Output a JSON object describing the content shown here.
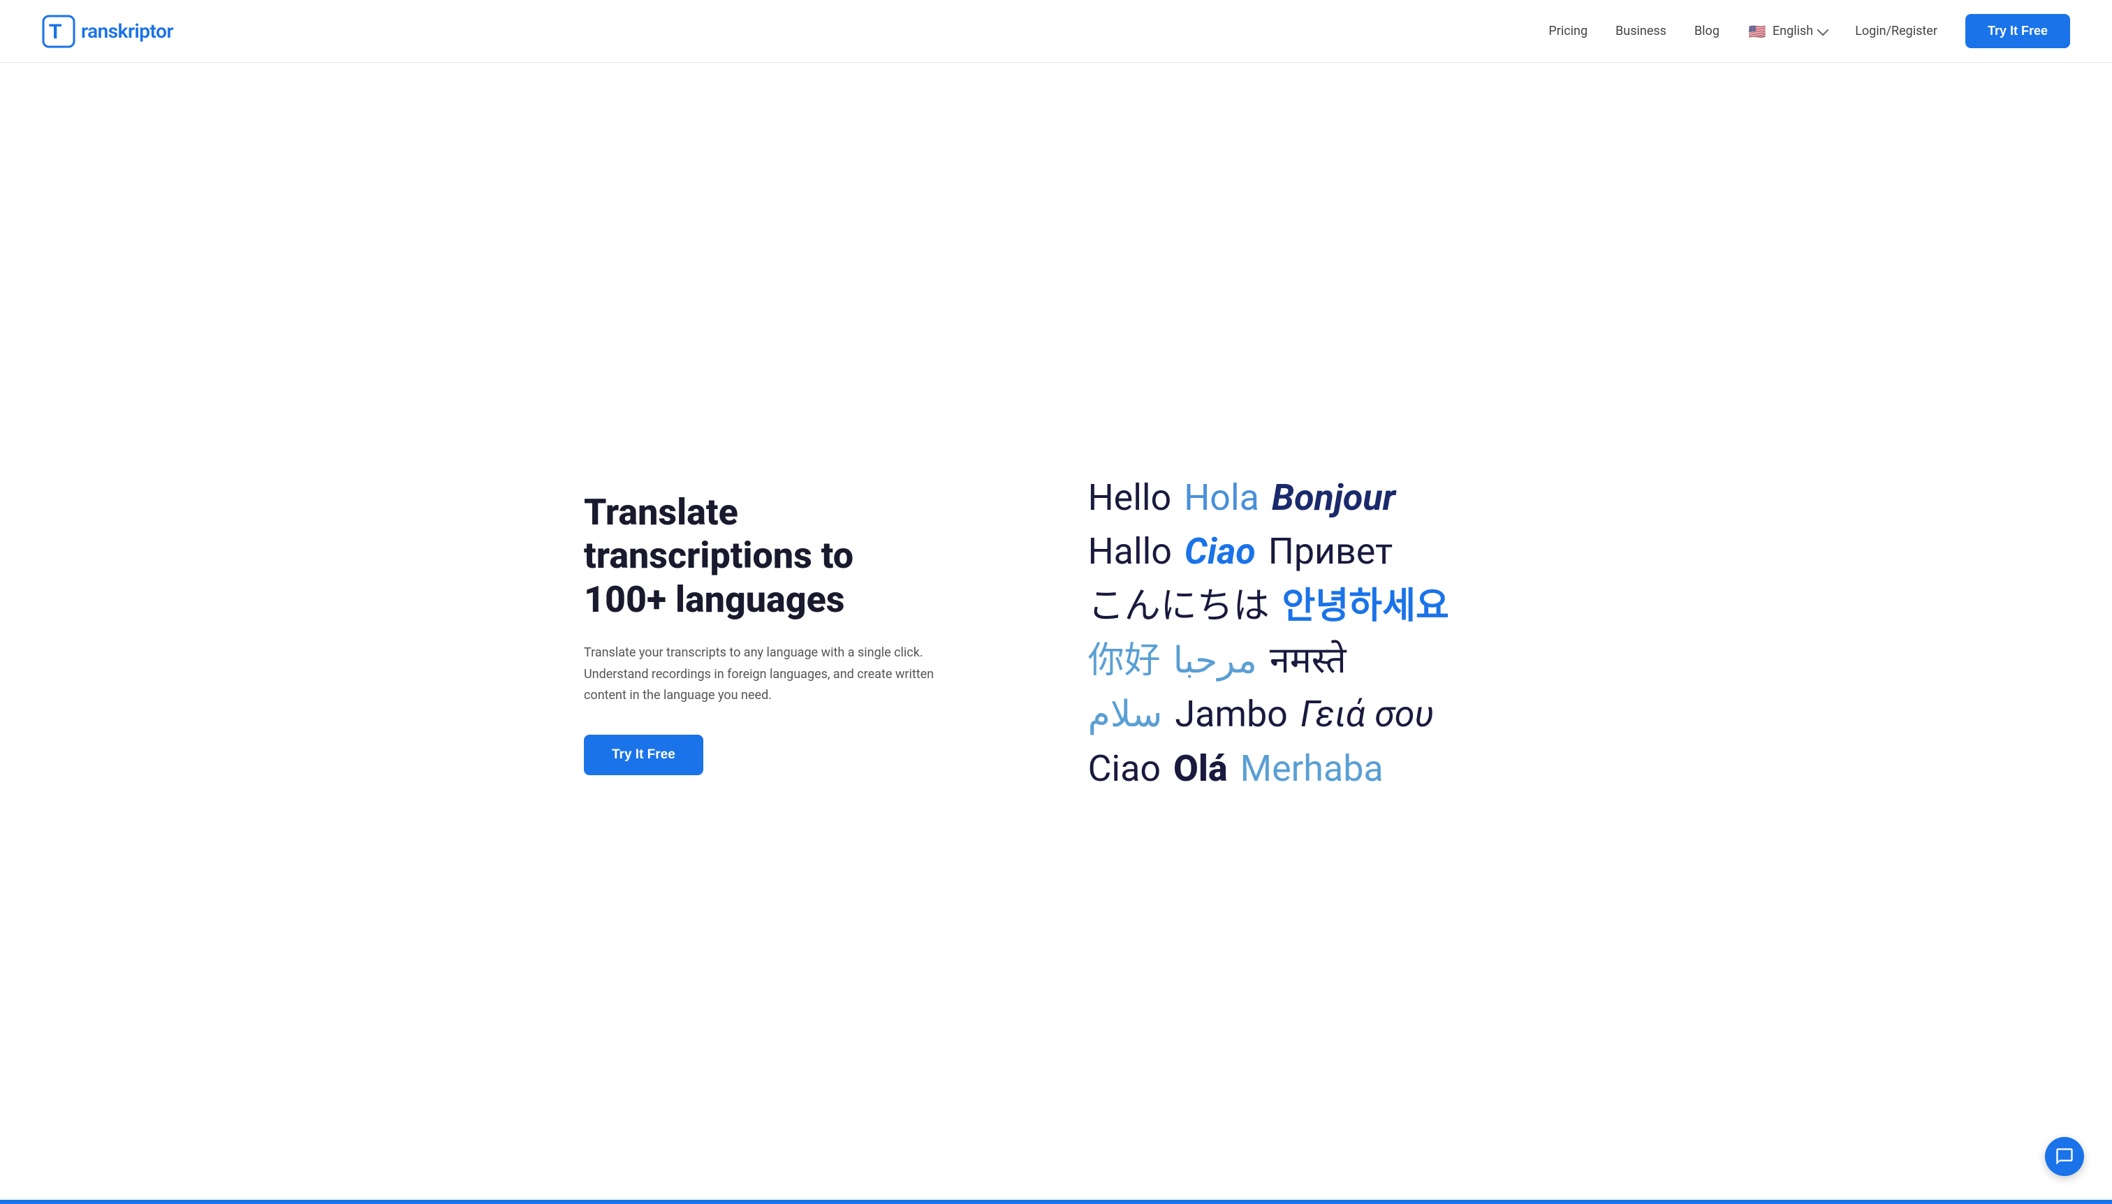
{
  "header": {
    "logo_text": "ranskriptor",
    "nav": {
      "pricing": "Pricing",
      "business": "Business",
      "blog": "Blog",
      "language": "English",
      "login": "Login/Register",
      "try_free": "Try It Free"
    }
  },
  "main": {
    "heading_line1": "Translate transcriptions to",
    "heading_line2": "100+ languages",
    "description": "Translate your transcripts to any language with a single click. Understand recordings in foreign languages, and create written content in the language you need.",
    "try_free": "Try It Free"
  },
  "lang_cloud": {
    "row1": [
      {
        "text": "Hello",
        "style": "dark"
      },
      {
        "text": "Hola",
        "style": "blue"
      },
      {
        "text": "Bonjour",
        "style": "dark-blue dark-blue-italic"
      }
    ],
    "row2": [
      {
        "text": "Hallo",
        "style": "dark"
      },
      {
        "text": "Ciao",
        "style": "blue-italic"
      },
      {
        "text": "Привет",
        "style": "dark-medium"
      }
    ],
    "row3": [
      {
        "text": "こんにちは",
        "style": "dark-jp"
      },
      {
        "text": "안녕하세요",
        "style": "blue-korean"
      }
    ],
    "row4": [
      {
        "text": "你好",
        "style": "blue-chinese"
      },
      {
        "text": "مرحبا",
        "style": "blue-arabic"
      },
      {
        "text": "नमस्ते",
        "style": "dark-hindi"
      }
    ],
    "row5": [
      {
        "text": "سلام",
        "style": "blue-light"
      },
      {
        "text": "Jambo",
        "style": "dark-medium"
      },
      {
        "text": "Γειά σου",
        "style": "dark-greek-italic"
      }
    ],
    "row6": [
      {
        "text": "Ciao",
        "style": "dark-ciao"
      },
      {
        "text": "Olá",
        "style": "dark-ola-bold"
      },
      {
        "text": "Merhaba",
        "style": "blue-merhaba"
      }
    ]
  }
}
